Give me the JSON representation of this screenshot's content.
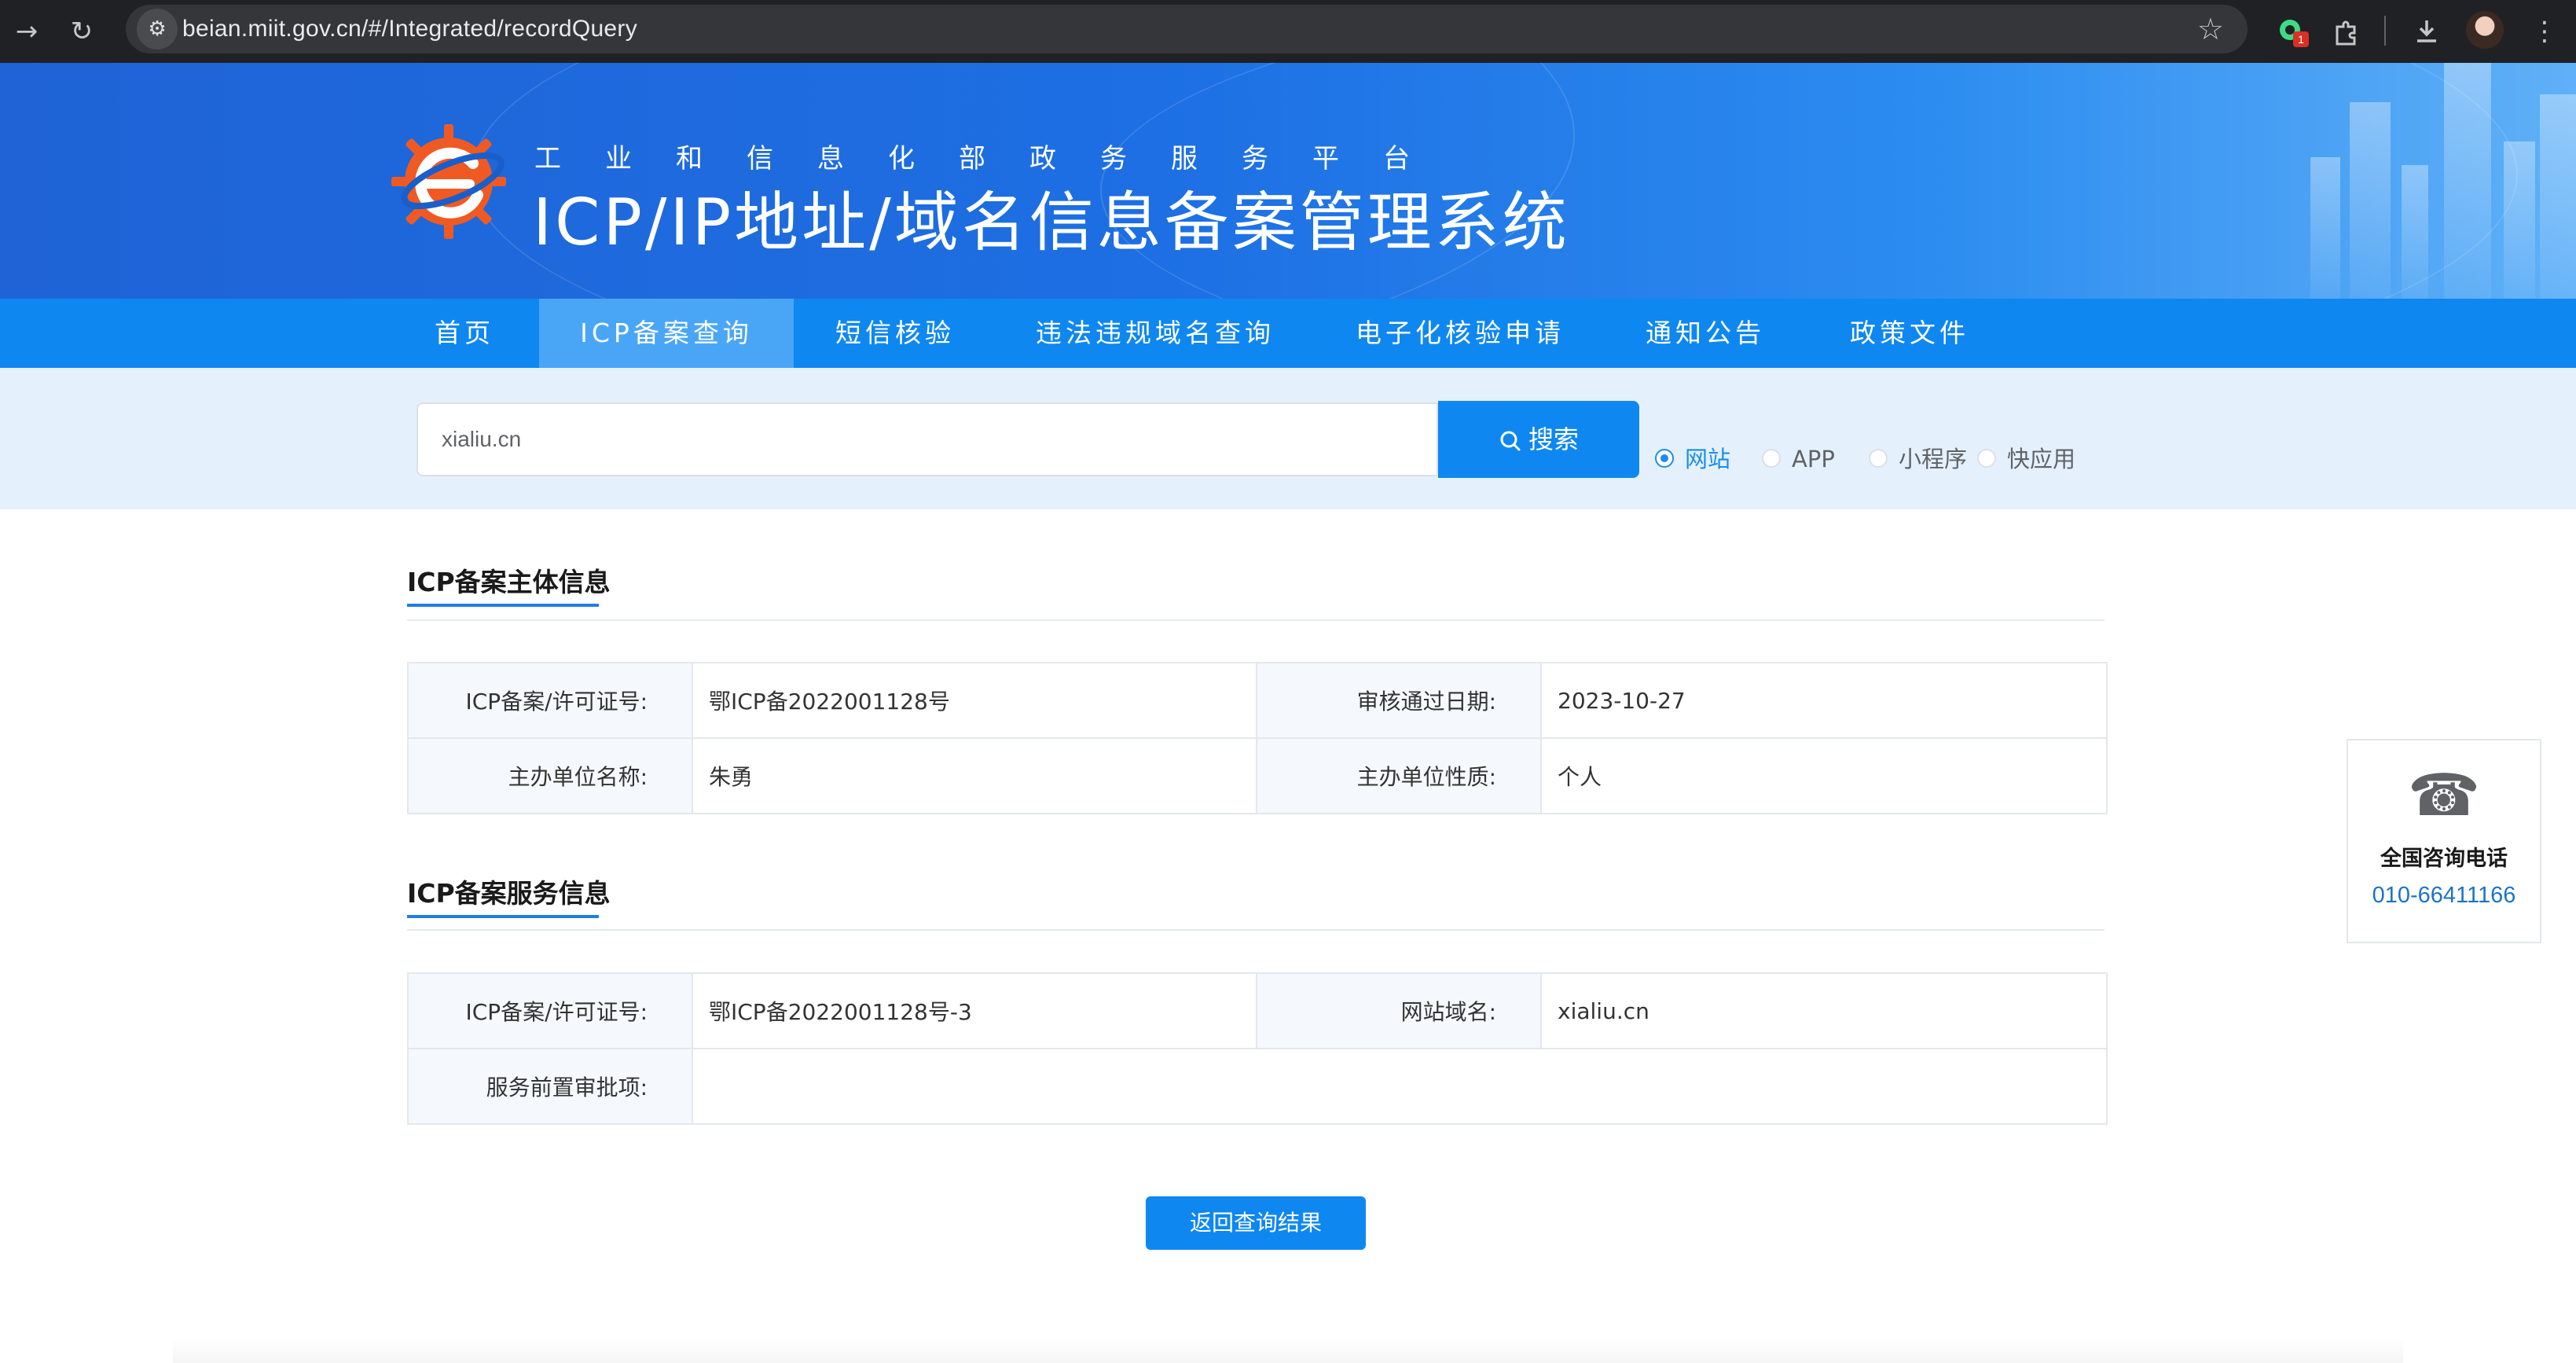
{
  "browser": {
    "url": "beian.miit.gov.cn/#/Integrated/recordQuery",
    "extension_badge": "1",
    "icons": [
      "forward-icon",
      "reload-icon",
      "site-settings-icon",
      "bookmark-star-icon",
      "extension-icon",
      "puzzle-icon",
      "download-icon",
      "avatar"
    ]
  },
  "banner": {
    "subtitle": "工业和信息化部政务服务平台",
    "title": "ICP/IP地址/域名信息备案管理系统"
  },
  "nav": {
    "items": [
      {
        "label": "首页",
        "active": false
      },
      {
        "label": "ICP备案查询",
        "active": true
      },
      {
        "label": "短信核验",
        "active": false
      },
      {
        "label": "违法违规域名查询",
        "active": false
      },
      {
        "label": "电子化核验申请",
        "active": false
      },
      {
        "label": "通知公告",
        "active": false
      },
      {
        "label": "政策文件",
        "active": false
      }
    ]
  },
  "search": {
    "value": "xialiu.cn",
    "button_label": "搜索",
    "options": [
      {
        "label": "网站",
        "checked": true
      },
      {
        "label": "APP",
        "checked": false
      },
      {
        "label": "小程序",
        "checked": false
      },
      {
        "label": "快应用",
        "checked": false
      }
    ]
  },
  "subject_info": {
    "title": "ICP备案主体信息",
    "rows": [
      {
        "l1": "ICP备案/许可证号:",
        "v1": "鄂ICP备2022001128号",
        "l2": "审核通过日期:",
        "v2": "2023-10-27"
      },
      {
        "l1": "主办单位名称:",
        "v1": "朱勇",
        "l2": "主办单位性质:",
        "v2": "个人"
      }
    ]
  },
  "service_info": {
    "title": "ICP备案服务信息",
    "row1": {
      "l1": "ICP备案/许可证号:",
      "v1": "鄂ICP备2022001128号-3",
      "l2": "网站域名:",
      "v2": "xialiu.cn"
    },
    "row2": {
      "l1": "服务前置审批项:",
      "v1": ""
    }
  },
  "back_button": "返回查询结果",
  "hotline": {
    "label": "全国咨询电话",
    "number": "010-66411166"
  },
  "colors": {
    "primary": "#0f87f0",
    "nav_active": "#49a6f7",
    "search_band": "#e4f1fd",
    "banner_start": "#1f63d6",
    "link_blue": "#1b73c7"
  }
}
